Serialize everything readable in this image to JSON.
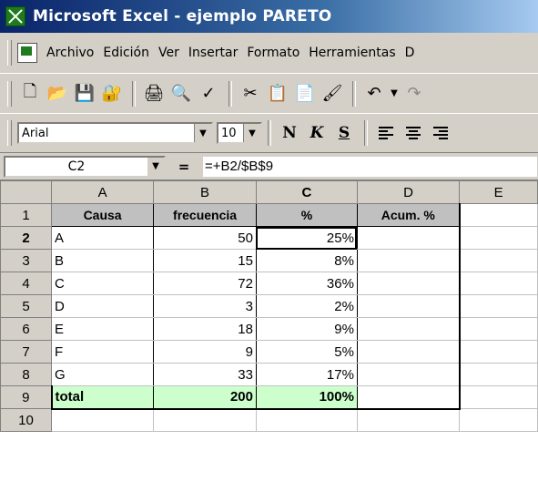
{
  "window": {
    "title": "Microsoft Excel - ejemplo PARETO"
  },
  "menu": [
    {
      "label": "Archivo"
    },
    {
      "label": "Edición"
    },
    {
      "label": "Ver"
    },
    {
      "label": "Insertar"
    },
    {
      "label": "Formato"
    },
    {
      "label": "Herramientas"
    },
    {
      "label": "D"
    }
  ],
  "format": {
    "font": "Arial",
    "size": "10",
    "bold": "N",
    "italic": "K",
    "underline": "S"
  },
  "formula_bar": {
    "cell_ref": "C2",
    "equals": "=",
    "formula": "=+B2/$B$9"
  },
  "columns": [
    "A",
    "B",
    "C",
    "D",
    "E"
  ],
  "rows": [
    {
      "n": "1",
      "a": "Causa",
      "b": "frecuencia",
      "c": "%",
      "d": "Acum. %"
    },
    {
      "n": "2",
      "a": "A",
      "b": "50",
      "c": "25%",
      "d": ""
    },
    {
      "n": "3",
      "a": "B",
      "b": "15",
      "c": "8%",
      "d": ""
    },
    {
      "n": "4",
      "a": "C",
      "b": "72",
      "c": "36%",
      "d": ""
    },
    {
      "n": "5",
      "a": "D",
      "b": "3",
      "c": "2%",
      "d": ""
    },
    {
      "n": "6",
      "a": "E",
      "b": "18",
      "c": "9%",
      "d": ""
    },
    {
      "n": "7",
      "a": "F",
      "b": "9",
      "c": "5%",
      "d": ""
    },
    {
      "n": "8",
      "a": "G",
      "b": "33",
      "c": "17%",
      "d": ""
    },
    {
      "n": "9",
      "a": "total",
      "b": "200",
      "c": "100%",
      "d": ""
    },
    {
      "n": "10",
      "a": "",
      "b": "",
      "c": "",
      "d": ""
    }
  ]
}
